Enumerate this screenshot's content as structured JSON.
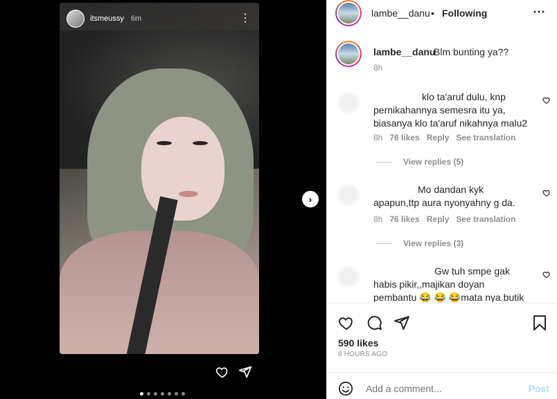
{
  "story": {
    "username": "itsmeussy",
    "time": "6m"
  },
  "post": {
    "username": "lambe__danu",
    "separator": "•",
    "follow_label": "Following",
    "caption_user": "lambe__danu",
    "caption_text": "Blm bunting ya??",
    "caption_time": "8h"
  },
  "comments": [
    {
      "text": "klo ta'aruf dulu, knp pernikahannya semesra itu ya, biasanya klo ta'aruf nikahnya malu2",
      "time": "8h",
      "likes": "76 likes",
      "reply": "Reply",
      "translate": "See translation",
      "replies": "View replies (5)"
    },
    {
      "text": "Mo dandan kyk apapun,ttp aura nyonyahny g da.",
      "time": "8h",
      "likes": "76 likes",
      "reply": "Reply",
      "translate": "See translation",
      "replies": "View replies (3)"
    },
    {
      "text": "Gw tuh smpe gak habis pikir,,majikan doyan pembantu 😂 😂 😂mata nya butik kali"
    }
  ],
  "actions": {
    "likes": "590 likes",
    "ago": "8 HOURS AGO"
  },
  "add_comment": {
    "placeholder": "Add a comment...",
    "post_label": "Post"
  },
  "icons": {
    "like": "heart-icon",
    "comment": "comment-icon",
    "share": "send-icon",
    "save": "bookmark-icon",
    "emoji": "smile-icon",
    "more": "more-icon",
    "next": "chevron-right-icon"
  },
  "colors": {
    "accent": "#0095f6",
    "post_disabled": "#b2dffc",
    "muted": "#8e8e8e"
  }
}
